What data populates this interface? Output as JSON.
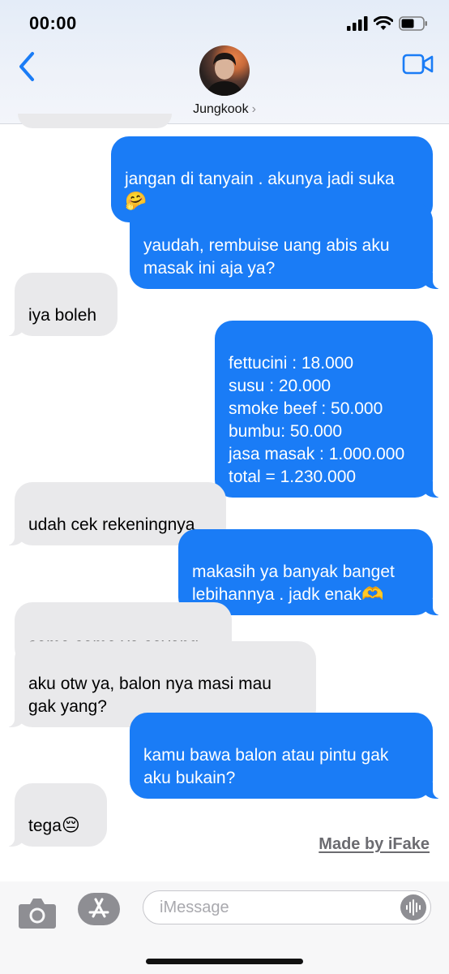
{
  "status_bar": {
    "time": "00:00"
  },
  "header": {
    "contact_name": "Jungkook",
    "chevron": "›"
  },
  "messages": [
    {
      "id": "m1",
      "side": "out",
      "text": "jangan di tanyain . akunya jadi suka",
      "emoji": "🤗"
    },
    {
      "id": "m2",
      "side": "out",
      "text": "yaudah, rembuise uang abis aku\nmasak ini aja ya?"
    },
    {
      "id": "m3",
      "side": "in",
      "text": "iya boleh"
    },
    {
      "id": "m4",
      "side": "out",
      "text": "fettucini : 18.000\nsusu : 20.000\nsmoke beef : 50.000\nbumbu: 50.000\njasa masak : 1.000.000\ntotal = 1.230.000"
    },
    {
      "id": "m5",
      "side": "in",
      "text": "udah cek rekeningnya"
    },
    {
      "id": "m6",
      "side": "out",
      "text": "makasih ya banyak banget\nlebihannya . jadk enak",
      "emoji": "🫶"
    },
    {
      "id": "m7",
      "side": "in",
      "text": "sama sama ya sayang."
    },
    {
      "id": "m8",
      "side": "in",
      "text": "aku otw ya, balon nya masi mau\ngak yang?"
    },
    {
      "id": "m9",
      "side": "out",
      "text": "kamu bawa balon atau pintu gak\naku bukain?"
    },
    {
      "id": "m10",
      "side": "in",
      "text": "tega",
      "emoji": "😔"
    }
  ],
  "watermark": "Made by iFake",
  "composer": {
    "placeholder": "iMessage"
  },
  "colors": {
    "outgoing_bubble": "#1a7cf6",
    "incoming_bubble": "#e9e9eb",
    "accent": "#1a7cf6"
  },
  "icons": {
    "back": "chevron-left-icon",
    "video": "video-camera-icon",
    "camera": "camera-icon",
    "app_store": "app-store-icon",
    "audio": "audio-waveform-icon",
    "signal": "cellular-signal-icon",
    "wifi": "wifi-icon",
    "battery": "battery-icon"
  }
}
